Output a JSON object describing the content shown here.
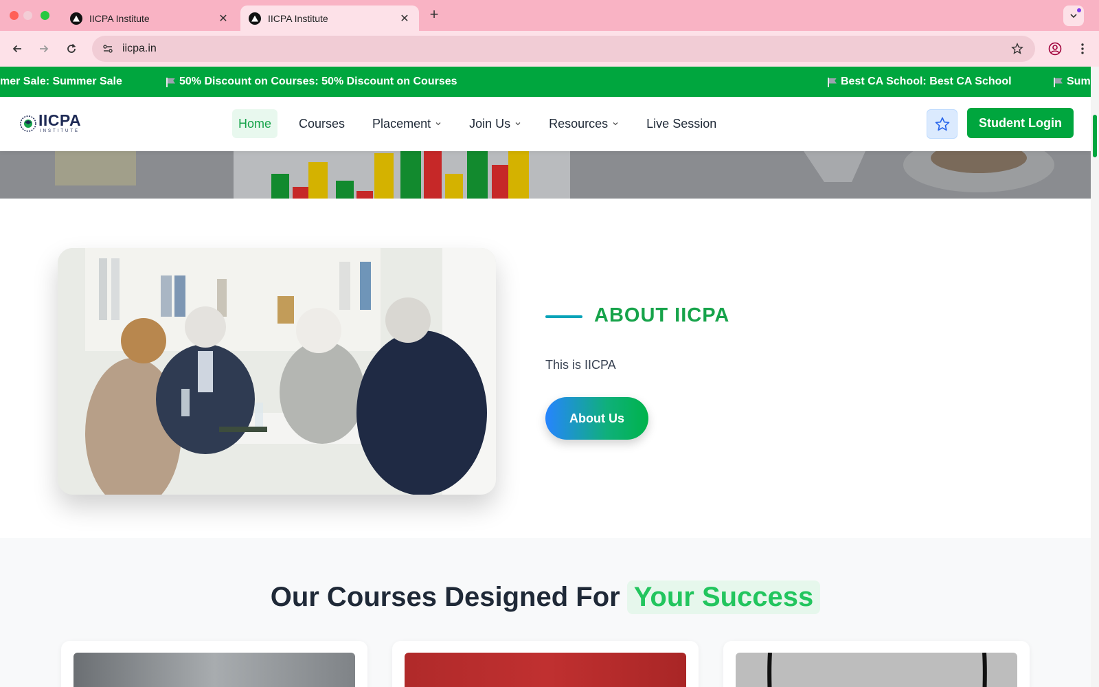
{
  "browser": {
    "tabs": [
      {
        "title": "IICPA Institute"
      },
      {
        "title": "IICPA Institute"
      }
    ],
    "new_tab_label": "+",
    "url": "iicpa.in"
  },
  "ticker": {
    "items": [
      "mer Sale: Summer Sale",
      "50% Discount on Courses: 50% Discount on Courses",
      "Best CA School: Best CA School",
      "Sum"
    ]
  },
  "header": {
    "logo_name": "IICPA",
    "logo_sub": "INSTITUTE",
    "nav": [
      {
        "label": "Home",
        "active": true,
        "dropdown": false
      },
      {
        "label": "Courses",
        "active": false,
        "dropdown": false
      },
      {
        "label": "Placement",
        "active": false,
        "dropdown": true
      },
      {
        "label": "Join Us",
        "active": false,
        "dropdown": true
      },
      {
        "label": "Resources",
        "active": false,
        "dropdown": true
      },
      {
        "label": "Live Session",
        "active": false,
        "dropdown": false
      }
    ],
    "login_label": "Student Login"
  },
  "about": {
    "title": "ABOUT IICPA",
    "text": "This is IICPA",
    "button_label": "About Us"
  },
  "courses": {
    "title_main": "Our Courses Designed For",
    "title_highlight": "Your Success",
    "cards": [
      {
        "image": "course-photo"
      },
      {
        "image": "course-photo"
      },
      {
        "image": "course-photo"
      }
    ]
  },
  "colors": {
    "brand_green": "#00a63e",
    "title_green": "#16a34a",
    "tab_pink": "#f9b3c4",
    "accent_teal": "#06a3b8",
    "dark_text": "#1f2937"
  }
}
